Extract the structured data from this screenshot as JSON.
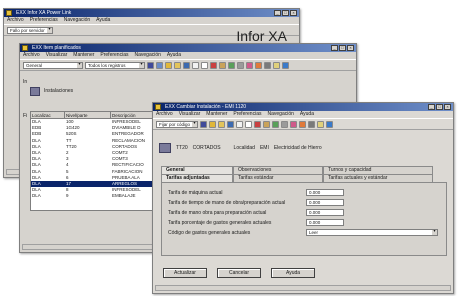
{
  "brand": "Infor XA",
  "win1": {
    "title": "EXX Infor XA Power Link",
    "menu": [
      "Archivo",
      "Preferencias",
      "Navegación",
      "Ayuda"
    ],
    "combo": "Fallo por servidor"
  },
  "win2": {
    "title": "EXX Item planificados",
    "menu": [
      "Archivo",
      "Visualizar",
      "Mantener",
      "Preferencias",
      "Navegación",
      "Ayuda"
    ],
    "combo1": "General",
    "combo2": "Todos los registros",
    "section_title": "Instalaciones",
    "grid_headers": [
      "Localizac",
      "Nivel/parte",
      "Descripción"
    ],
    "grid_rows": [
      [
        "DLA",
        "100",
        "INFRESODEL"
      ],
      [
        "EDB",
        "1G420",
        "DVIAMBILE D"
      ],
      [
        "EDB",
        "520S",
        "ENTREGADOR"
      ],
      [
        "DLA",
        "TT",
        "RECLAMACION"
      ],
      [
        "DLA",
        "TT20",
        "CORTADOS"
      ],
      [
        "DLA",
        "2",
        "COMT2"
      ],
      [
        "DLA",
        "3",
        "COMT3"
      ],
      [
        "DLA",
        "4",
        "RECTIFICACIO"
      ],
      [
        "DLA",
        "5",
        "FABRICACION"
      ],
      [
        "DLA",
        "6",
        "PRUEBA ALA"
      ],
      [
        "DLA",
        "17",
        "ARREGLOS"
      ],
      [
        "DLA",
        "8",
        "INFRESODEL"
      ],
      [
        "DLA",
        "9",
        "EMBALAJE"
      ]
    ],
    "selected_row": 10
  },
  "win3": {
    "title": "EXX Cambiar Instalación - EMI 1120",
    "menu": [
      "Archivo",
      "Visualizar",
      "Mantener",
      "Preferencias",
      "Navegación",
      "Ayuda"
    ],
    "combo": "Fijar por código",
    "info": [
      "TT20",
      "CORTADOS",
      "Localidad",
      "EMI",
      "Electricidad de Hierro"
    ],
    "tabs": [
      "General",
      "Observaciones",
      "Turnos y capacidad"
    ],
    "subtabs": [
      "Tarifas adjuntadas",
      "Tarifas estándar",
      "Tarifas actuales y estándar"
    ],
    "fields": [
      {
        "label": "Tarifa de máquina actual",
        "value": "0.000"
      },
      {
        "label": "Tarifa de tiempo de mano de obra/preparación actual",
        "value": "0.000"
      },
      {
        "label": "Tarifa de mano obra para preparación actual",
        "value": "0.000"
      },
      {
        "label": "Tarifa porcentaje de gastos generales actuales",
        "value": "0.000"
      },
      {
        "label": "Código de gastos generales actuales",
        "value": "Leer"
      }
    ],
    "buttons": [
      "Actualizar",
      "Cancelar",
      "Ayuda"
    ]
  }
}
